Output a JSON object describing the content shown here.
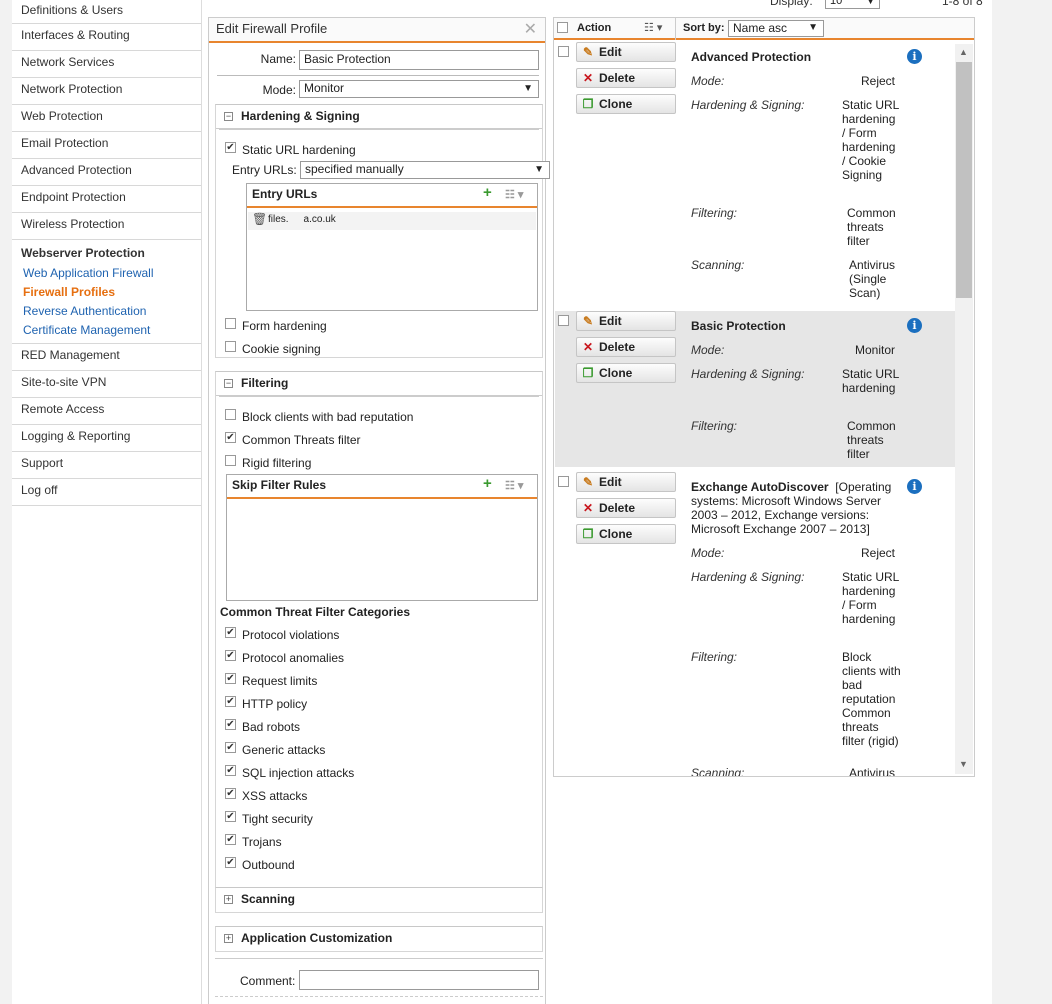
{
  "sidebar": {
    "items_top": [
      "Definitions & Users",
      "Interfaces & Routing",
      "Network Services",
      "Network Protection",
      "Web Protection",
      "Email Protection",
      "Advanced Protection",
      "Endpoint Protection",
      "Wireless Protection"
    ],
    "active": "Webserver Protection",
    "sub": [
      "Web Application Firewall",
      "Firewall Profiles",
      "Reverse Authentication",
      "Certificate Management"
    ],
    "items_bottom": [
      "RED Management",
      "Site-to-site VPN",
      "Remote Access",
      "Logging & Reporting",
      "Support",
      "Log off"
    ]
  },
  "topbar": {
    "display_label": "Display:",
    "display_value": "10",
    "count": "1-8 of 8"
  },
  "edit": {
    "title": "Edit Firewall Profile",
    "name_label": "Name:",
    "name_value": "Basic Protection",
    "mode_label": "Mode:",
    "mode_value": "Monitor",
    "hardening_title": "Hardening & Signing",
    "static_url": "Static URL hardening",
    "entry_urls_label": "Entry URLs:",
    "entry_urls_value": "specified manually",
    "entry_box_title": "Entry URLs",
    "entry_url": "files.  a.co.uk",
    "form_hardening": "Form hardening",
    "cookie_signing": "Cookie signing",
    "filtering_title": "Filtering",
    "block_clients": "Block clients with bad reputation",
    "common_threats": "Common Threats filter",
    "rigid": "Rigid filtering",
    "skip_rules_title": "Skip Filter Rules",
    "categories_title": "Common Threat Filter Categories",
    "categories": [
      "Protocol violations",
      "Protocol anomalies",
      "Request limits",
      "HTTP policy",
      "Bad robots",
      "Generic attacks",
      "SQL injection attacks",
      "XSS attacks",
      "Tight security",
      "Trojans",
      "Outbound"
    ],
    "scanning_title": "Scanning",
    "appcust_title": "Application Customization",
    "comment_label": "Comment:"
  },
  "list": {
    "action_label": "Action",
    "sortby_label": "Sort by:",
    "sort_value": "Name asc",
    "buttons": {
      "edit": "Edit",
      "delete": "Delete",
      "clone": "Clone"
    },
    "labels": {
      "mode": "Mode:",
      "hardening": "Hardening & Signing:",
      "filtering": "Filtering:",
      "scanning": "Scanning:"
    },
    "profiles": [
      {
        "name": "Advanced Protection",
        "mode": "Reject",
        "hardening": "Static URL hardening / Form hardening / Cookie Signing",
        "filtering": "Common threats filter",
        "scanning": "Antivirus (Single Scan)"
      },
      {
        "name": "Basic Protection",
        "mode": "Monitor",
        "hardening": "Static URL hardening",
        "filtering": "Common threats filter"
      },
      {
        "name": "Exchange AutoDiscover",
        "note": "[Operating systems: Microsoft Windows Server 2003 – 2012, Exchange versions: Microsoft Exchange 2007 – 2013]",
        "mode": "Reject",
        "hardening": "Static URL hardening / Form hardening",
        "filtering": "Block clients with bad reputation Common threats filter (rigid)",
        "scanning_partial": "Scanning:",
        "scanning_val_partial": "Antivirus"
      }
    ]
  },
  "colors": {
    "accent": "#e8852e",
    "link": "#1f63b0",
    "active_sub": "#e66f10",
    "info": "#1b6fbf",
    "add": "#3a9a2f"
  }
}
